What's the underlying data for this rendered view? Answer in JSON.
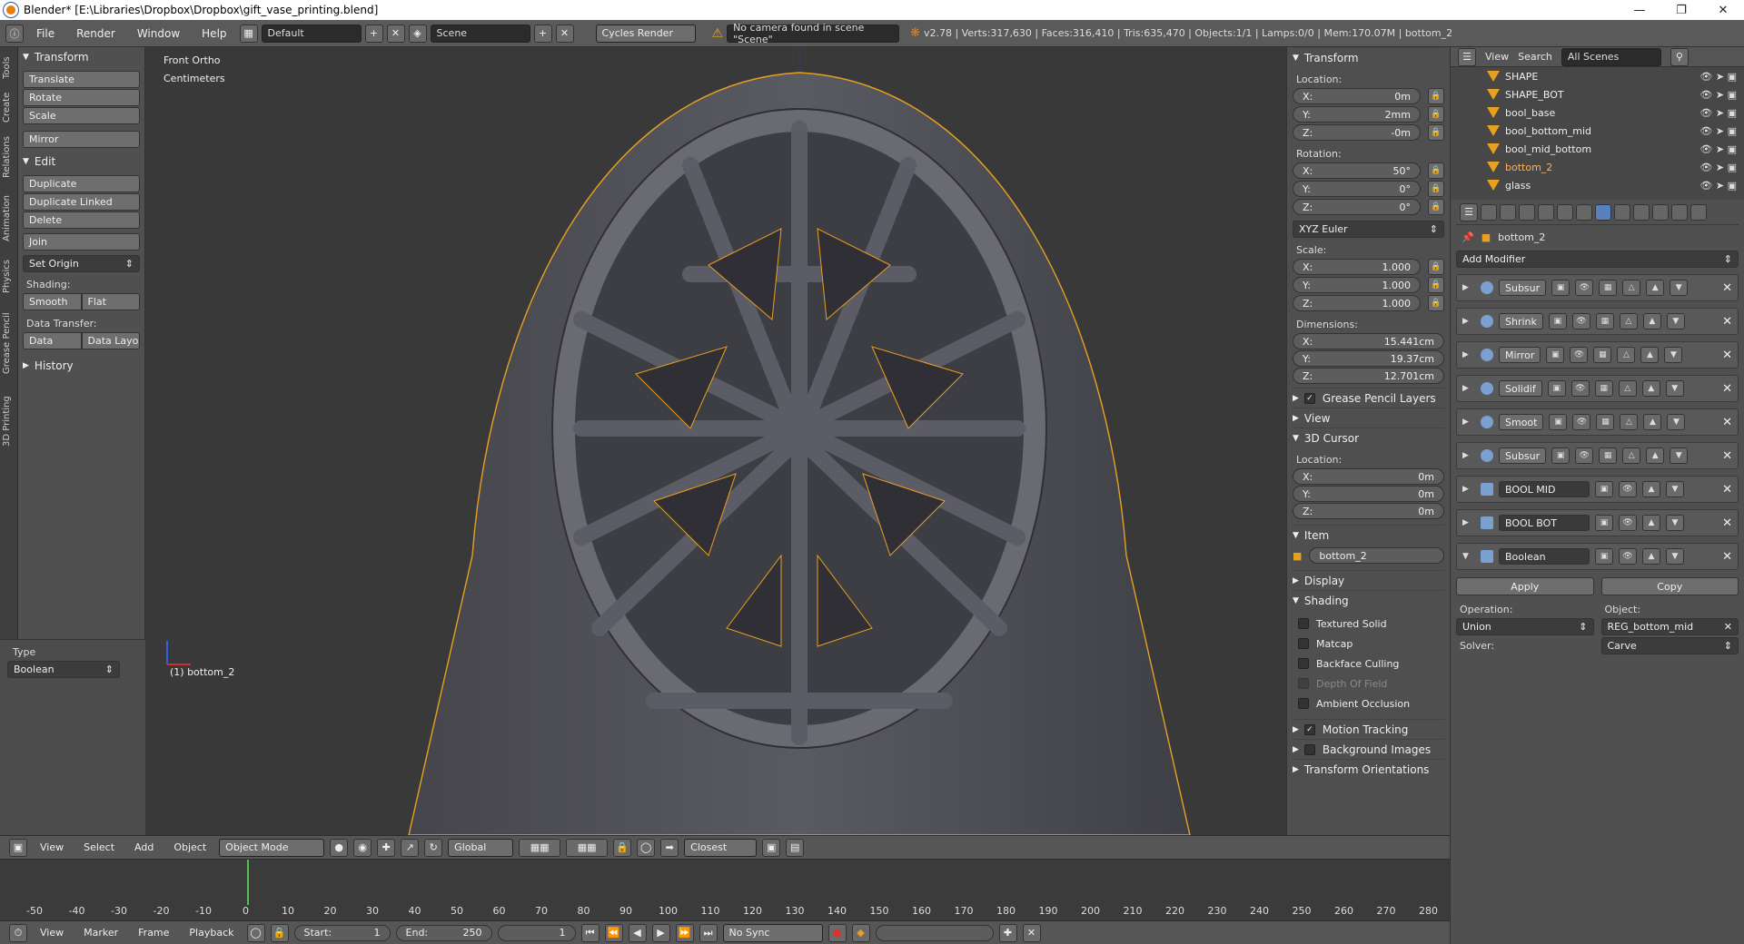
{
  "window": {
    "title": "Blender* [E:\\Libraries\\Dropbox\\Dropbox\\gift_vase_printing.blend]"
  },
  "menu": {
    "items": [
      "File",
      "Render",
      "Window",
      "Help"
    ],
    "layout": "Default",
    "scene": "Scene",
    "engine": "Cycles Render",
    "warning": "No camera found in scene \"Scene\"",
    "stats": "v2.78 | Verts:317,630 | Faces:316,410 | Tris:635,470 | Objects:1/1 | Lamps:0/0 | Mem:170.07M | bottom_2"
  },
  "tabs": [
    "Tools",
    "Create",
    "Relations",
    "Animation",
    "Physics",
    "Grease Pencil",
    "3D Printing"
  ],
  "toolshelf": {
    "transform_head": "Transform",
    "translate": "Translate",
    "rotate": "Rotate",
    "scale": "Scale",
    "mirror": "Mirror",
    "edit_head": "Edit",
    "duplicate": "Duplicate",
    "duplicate_linked": "Duplicate Linked",
    "delete": "Delete",
    "join": "Join",
    "set_origin": "Set Origin",
    "shading_label": "Shading:",
    "smooth": "Smooth",
    "flat": "Flat",
    "data_transfer_label": "Data Transfer:",
    "data": "Data",
    "data_layo": "Data Layo",
    "history_head": "History",
    "type_label": "Type",
    "type_value": "Boolean"
  },
  "viewport": {
    "view_name": "Front Ortho",
    "units": "Centimeters",
    "active": "(1) bottom_2"
  },
  "npanel": {
    "transform_head": "Transform",
    "location_label": "Location:",
    "loc_x": "0m",
    "loc_y": "2mm",
    "loc_z": "-0m",
    "rotation_label": "Rotation:",
    "rot_x": "50°",
    "rot_y": "0°",
    "rot_z": "0°",
    "rot_mode": "XYZ Euler",
    "scale_label": "Scale:",
    "scl_x": "1.000",
    "scl_y": "1.000",
    "scl_z": "1.000",
    "dims_label": "Dimensions:",
    "dim_x": "15.441cm",
    "dim_y": "19.37cm",
    "dim_z": "12.701cm",
    "grease_pencil": "Grease Pencil Layers",
    "view_head": "View",
    "cursor_head": "3D Cursor",
    "cursor_loc_label": "Location:",
    "cur_x": "0m",
    "cur_y": "0m",
    "cur_z": "0m",
    "item_head": "Item",
    "item_name": "bottom_2",
    "display_head": "Display",
    "shading_head": "Shading",
    "textured_solid": "Textured Solid",
    "matcap": "Matcap",
    "backface": "Backface Culling",
    "dof": "Depth Of Field",
    "ao": "Ambient Occlusion",
    "motion_tracking": "Motion Tracking",
    "background_images": "Background Images",
    "transform_orient": "Transform Orientations",
    "axis_x": "X:",
    "axis_y": "Y:",
    "axis_z": "Z:"
  },
  "outliner": {
    "view": "View",
    "search": "Search",
    "filter": "All Scenes",
    "items": [
      "SHAPE",
      "SHAPE_BOT",
      "bool_base",
      "bool_bottom_mid",
      "bool_mid_bottom",
      "bottom_2",
      "glass"
    ]
  },
  "props": {
    "object_name": "bottom_2",
    "add_modifier": "Add Modifier",
    "modifiers": [
      "Subsur",
      "Shrink",
      "Mirror",
      "Solidif",
      "Smoot",
      "Subsur",
      "BOOL MID",
      "BOOL BOT",
      "Boolean"
    ],
    "apply": "Apply",
    "copy": "Copy",
    "operation_label": "Operation:",
    "operation": "Union",
    "object_label": "Object:",
    "object": "REG_bottom_mid",
    "solver_label": "Solver:",
    "solver": "Carve"
  },
  "header3d": {
    "items": [
      "View",
      "Select",
      "Add",
      "Object"
    ],
    "mode": "Object Mode",
    "orientation": "Global",
    "snap": "Closest"
  },
  "timeline": {
    "ticks": [
      "-50",
      "-40",
      "-30",
      "-20",
      "-10",
      "0",
      "10",
      "20",
      "30",
      "40",
      "50",
      "60",
      "70",
      "80",
      "90",
      "100",
      "110",
      "120",
      "130",
      "140",
      "150",
      "160",
      "170",
      "180",
      "190",
      "200",
      "210",
      "220",
      "230",
      "240",
      "250",
      "260",
      "270",
      "280"
    ],
    "items": [
      "View",
      "Marker",
      "Frame",
      "Playback"
    ],
    "start_label": "Start:",
    "start": "1",
    "end_label": "End:",
    "end": "250",
    "current": "1",
    "sync": "No Sync"
  }
}
